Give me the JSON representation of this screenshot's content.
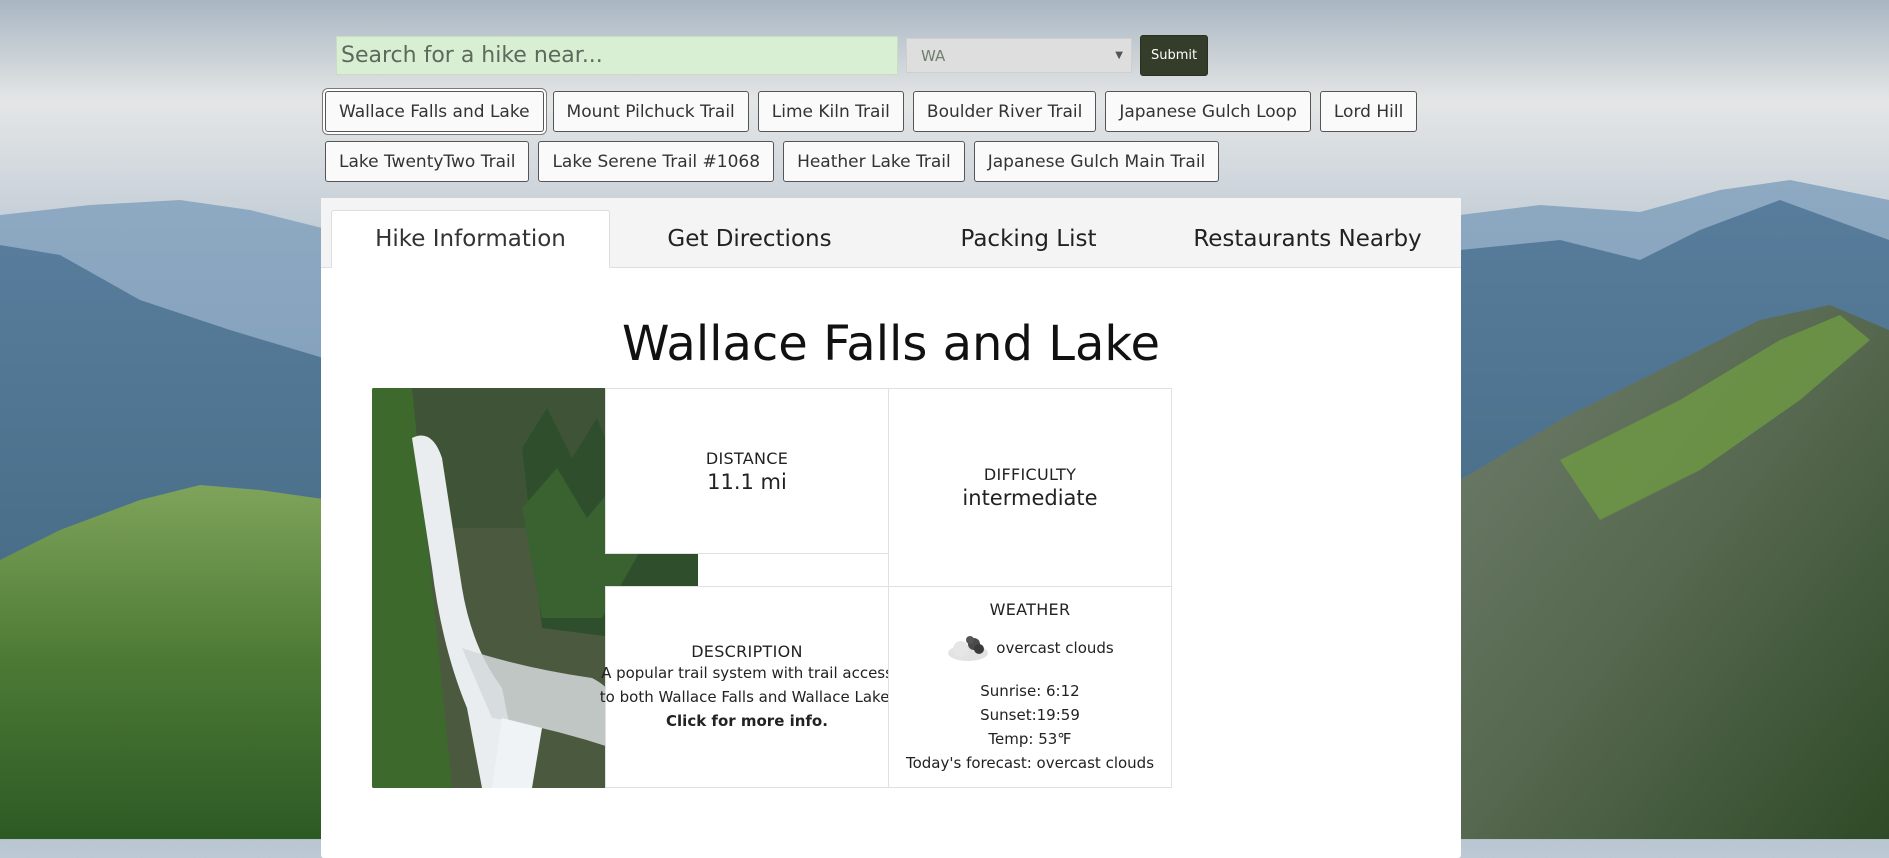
{
  "search": {
    "placeholder": "Search for a hike near...",
    "state": "WA",
    "submit_label": "Submit"
  },
  "trails": {
    "row1": [
      "Wallace Falls and Lake",
      "Mount Pilchuck Trail",
      "Lime Kiln Trail",
      "Boulder River Trail",
      "Japanese Gulch Loop",
      "Lord Hill"
    ],
    "row2": [
      "Lake TwentyTwo Trail",
      "Lake Serene Trail #1068",
      "Heather Lake Trail",
      "Japanese Gulch Main Trail"
    ],
    "selected": "Wallace Falls and Lake"
  },
  "tabs": [
    {
      "label": "Hike Information",
      "active": true
    },
    {
      "label": "Get Directions",
      "active": false
    },
    {
      "label": "Packing List",
      "active": false
    },
    {
      "label": "Restaurants Nearby",
      "active": false
    }
  ],
  "hike": {
    "title": "Wallace Falls and Lake",
    "distance_label": "DISTANCE",
    "distance": "11.1 mi",
    "difficulty_label": "DIFFICULTY",
    "difficulty": "intermediate",
    "description_label": "DESCRIPTION",
    "description": "A popular trail system with trail access to both Wallace Falls and Wallace Lake.",
    "more_link": "Click for more info.",
    "weather": {
      "label": "WEATHER",
      "icon": "overcast-clouds-icon",
      "summary": "overcast clouds",
      "sunrise": "Sunrise: 6:12",
      "sunset": "Sunset:19:59",
      "temp": "Temp: 53℉",
      "forecast": "Today's forecast: overcast clouds"
    }
  },
  "colors": {
    "search_bg": "#d9efd4",
    "submit_bg": "#343d2a"
  }
}
